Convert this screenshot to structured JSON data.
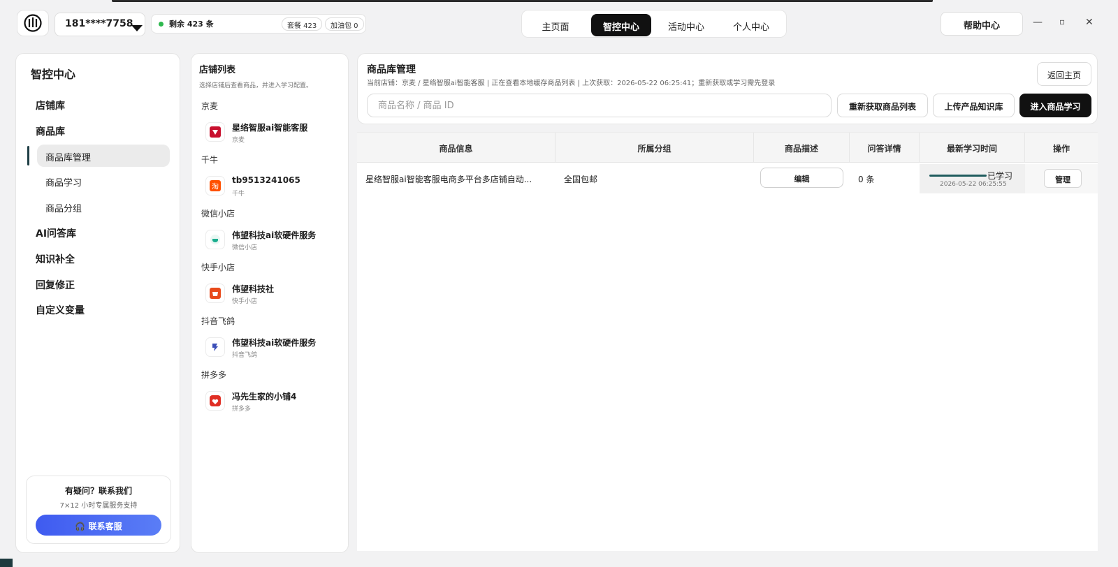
{
  "header": {
    "account": "181****7758",
    "quota": {
      "remaining": "剩余 423 条",
      "plan": "套餐 423",
      "addon": "加油包 0"
    },
    "tabs": [
      {
        "label": "主页面",
        "active": false
      },
      {
        "label": "智控中心",
        "active": true
      },
      {
        "label": "活动中心",
        "active": false
      },
      {
        "label": "个人中心",
        "active": false
      }
    ],
    "help": "帮助中心",
    "window": {
      "minimize": "—",
      "maximize": "▫",
      "close": "✕"
    }
  },
  "sidebar": {
    "title": "智控中心",
    "items": [
      {
        "label": "店铺库"
      },
      {
        "label": "商品库"
      },
      {
        "label": "商品库管理",
        "active": true
      },
      {
        "label": "商品学习"
      },
      {
        "label": "商品分组"
      },
      {
        "label": "AI问答库"
      },
      {
        "label": "知识补全"
      },
      {
        "label": "回复修正"
      },
      {
        "label": "自定义变量"
      }
    ],
    "contact": {
      "title": "有疑问？联系我们",
      "subtitle": "7×12 小时专属服务支持",
      "button": "联系客服"
    }
  },
  "shops": {
    "title": "店铺列表",
    "desc": "选择店铺后查看商品，并进入学习配置。",
    "groups": [
      {
        "platform": "京麦",
        "name": "星络智服ai智能客服",
        "sub": "京麦",
        "icon": "jd-icon",
        "color": "#c8102e"
      },
      {
        "platform": "千牛",
        "name": "tb9513241065",
        "sub": "千牛",
        "icon": "taobao-icon",
        "color": "#ff5000"
      },
      {
        "platform": "微信小店",
        "name": "伟望科技ai软硬件服务",
        "sub": "微信小店",
        "icon": "wechat-shop-icon",
        "color": "#1aad8e"
      },
      {
        "platform": "快手小店",
        "name": "伟望科技社",
        "sub": "快手小店",
        "icon": "kuaishou-icon",
        "color": "#e84a1b"
      },
      {
        "platform": "抖音飞鸽",
        "name": "伟望科技ai软硬件服务",
        "sub": "抖音飞鸽",
        "icon": "douyin-icon",
        "color": "#3c4fb8"
      },
      {
        "platform": "拼多多",
        "name": "冯先生家的小铺4",
        "sub": "拼多多",
        "icon": "pdd-icon",
        "color": "#e02e24"
      }
    ]
  },
  "main": {
    "title": "商品库管理",
    "desc": "当前店铺：京麦 / 星络智服ai智能客服 | 正在查看本地缓存商品列表 | 上次获取：2026-05-22 06:25:41；重新获取或学习需先登录",
    "back": "返回主页",
    "search_placeholder": "商品名称 / 商品 ID",
    "buttons": {
      "refresh": "重新获取商品列表",
      "upload": "上传产品知识库",
      "learn": "进入商品学习"
    },
    "table": {
      "headers": [
        "商品信息",
        "所属分组",
        "商品描述",
        "问答详情",
        "最新学习时间",
        "操作"
      ],
      "rows": [
        {
          "info": "星络智服ai智能客服电商多平台多店铺自动...",
          "group": "全国包邮",
          "desc_btn": "编辑",
          "qa": "0 条",
          "status": "已学习",
          "time": "2026-05-22 06:25:55",
          "action": "管理"
        }
      ]
    }
  }
}
